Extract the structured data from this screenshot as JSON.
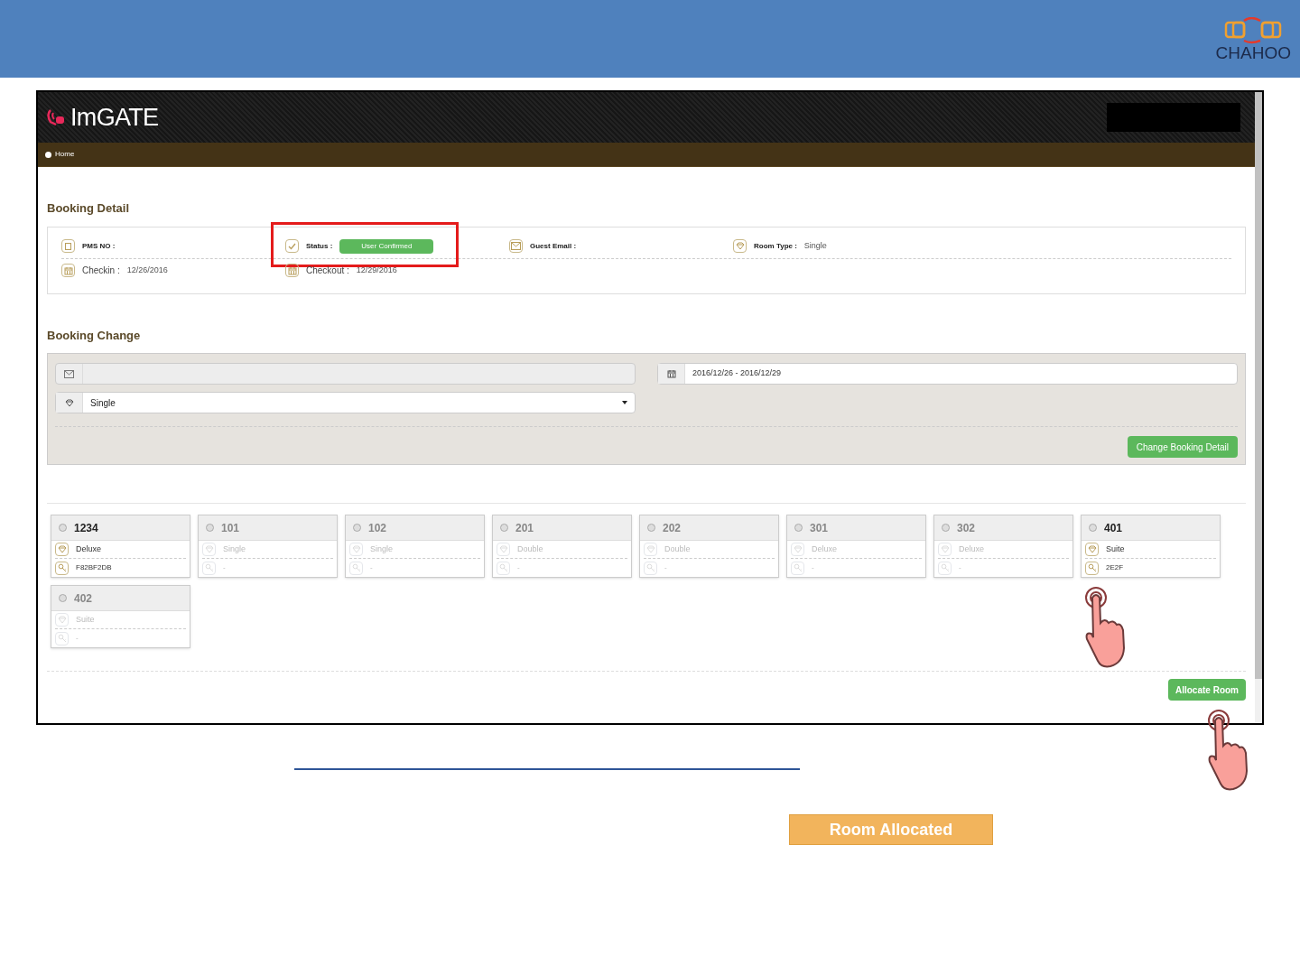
{
  "slide": {
    "logo_text": "CHAHOO",
    "caption_button": "Room Allocated"
  },
  "app": {
    "brand": "ImGATE",
    "breadcrumb": "Home"
  },
  "booking_detail": {
    "title": "Booking Detail",
    "fields": [
      {
        "kind": "plain",
        "label": "PMS NO :"
      },
      {
        "kind": "status",
        "label": "Status :",
        "value": "User Confirmed",
        "highlighted": true
      },
      {
        "kind": "plain",
        "label": "Guest Email :"
      },
      {
        "kind": "plain",
        "label": "Room Type :",
        "value": "Single"
      },
      {
        "kind": "date",
        "label": "Checkin :",
        "value": "12/26/2016"
      },
      {
        "kind": "date",
        "label": "Checkout :",
        "value": "12/29/2016"
      }
    ]
  },
  "booking_change": {
    "title": "Booking Change",
    "date_range": "2016/12/26 - 2016/12/29",
    "room_type": "Single",
    "button": "Change Booking Detail"
  },
  "rooms": [
    {
      "number": "1234",
      "type": "Deluxe",
      "code": "F82BF2DB",
      "disabled": false,
      "tapped": false
    },
    {
      "number": "101",
      "type": "Single",
      "code": "-",
      "disabled": true,
      "tapped": false
    },
    {
      "number": "102",
      "type": "Single",
      "code": "-",
      "disabled": true,
      "tapped": false
    },
    {
      "number": "201",
      "type": "Double",
      "code": "-",
      "disabled": true,
      "tapped": false
    },
    {
      "number": "202",
      "type": "Double",
      "code": "-",
      "disabled": true,
      "tapped": false
    },
    {
      "number": "301",
      "type": "Deluxe",
      "code": "-",
      "disabled": true,
      "tapped": false
    },
    {
      "number": "302",
      "type": "Deluxe",
      "code": "-",
      "disabled": true,
      "tapped": false
    },
    {
      "number": "401",
      "type": "Suite",
      "code": "2E2F",
      "disabled": false,
      "tapped": true
    },
    {
      "number": "402",
      "type": "Suite",
      "code": "-",
      "disabled": true,
      "tapped": false
    }
  ],
  "allocate_button": "Allocate Room"
}
